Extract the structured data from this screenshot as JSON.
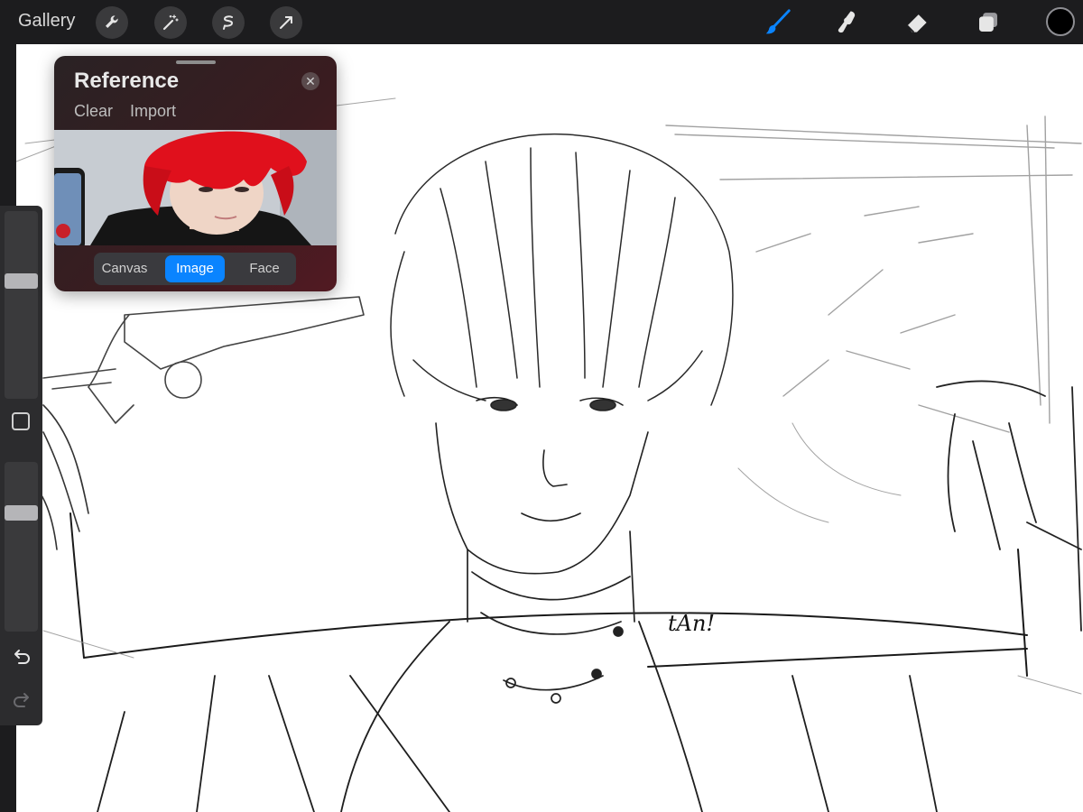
{
  "toolbar": {
    "gallery_label": "Gallery",
    "left_tools": [
      "wrench-icon",
      "magic-wand-icon",
      "selection-icon",
      "transform-arrow-icon"
    ],
    "right_tools": [
      "brush-icon",
      "smudge-icon",
      "eraser-icon",
      "layers-icon"
    ],
    "active_tool": "brush-icon",
    "accent_color": "#0a84ff",
    "current_color": "#000000"
  },
  "reference_panel": {
    "title": "Reference",
    "actions": {
      "clear": "Clear",
      "import": "Import"
    },
    "tabs": [
      "Canvas",
      "Image",
      "Face"
    ],
    "selected_tab": "Image"
  },
  "sidebar": {
    "brush_size_level": 0.64,
    "opacity_level": 0.72
  },
  "canvas": {
    "signature_text": "tAn!"
  }
}
